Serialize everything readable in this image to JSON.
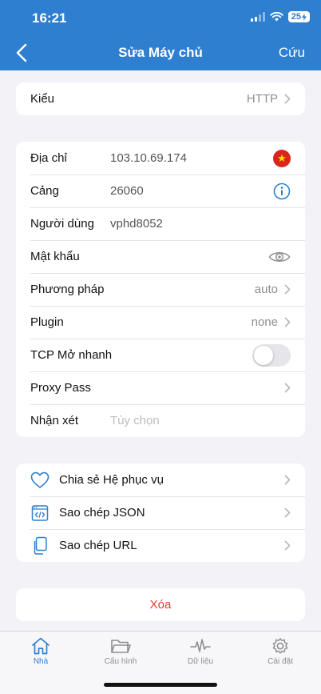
{
  "status": {
    "time": "16:21",
    "battery": "25"
  },
  "nav": {
    "title": "Sửa Máy chủ",
    "save": "Cứu"
  },
  "type_row": {
    "label": "Kiểu",
    "value": "HTTP"
  },
  "fields": {
    "address": {
      "label": "Địa chỉ",
      "value": "103.10.69.174"
    },
    "port": {
      "label": "Cảng",
      "value": "26060"
    },
    "user": {
      "label": "Người dùng",
      "value": "vphd8052"
    },
    "password": {
      "label": "Mật khẩu"
    },
    "method": {
      "label": "Phương pháp",
      "value": "auto"
    },
    "plugin": {
      "label": "Plugin",
      "value": "none"
    },
    "tcp_fast_open": {
      "label": "TCP Mở nhanh",
      "enabled": false
    },
    "proxy_pass": {
      "label": "Proxy Pass"
    },
    "remark": {
      "label": "Nhận xét",
      "placeholder": "Tùy chọn"
    }
  },
  "actions": {
    "share": "Chia sẻ Hệ phục vụ",
    "copy_json": "Sao chép JSON",
    "copy_url": "Sao chép URL"
  },
  "delete_label": "Xóa",
  "tabs": [
    {
      "label": "Nhà",
      "icon": "home-icon",
      "active": true
    },
    {
      "label": "Cấu hình",
      "icon": "folder-icon",
      "active": false
    },
    {
      "label": "Dữ liệu",
      "icon": "activity-icon",
      "active": false
    },
    {
      "label": "Cài đặt",
      "icon": "gear-icon",
      "active": false
    }
  ],
  "colors": {
    "accent": "#2f7fd1",
    "destructive": "#e53935",
    "background": "#f2f2f7"
  }
}
